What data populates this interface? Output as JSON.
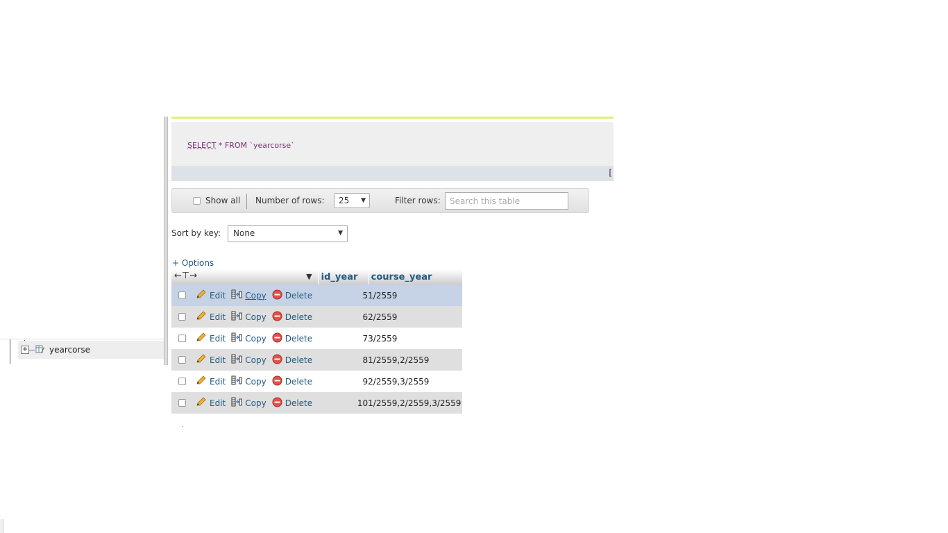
{
  "sidebar": {
    "table_item": "yearcorse",
    "expand_icon": "plus-square-icon",
    "table_icon": "table-icon"
  },
  "query": {
    "keyword": "SELECT",
    "rest": " * FROM `yearcorse`",
    "bracket": "["
  },
  "toolbar": {
    "show_all": "Show all",
    "rows_label": "Number of rows:",
    "rows_value": "25",
    "filter_label": "Filter rows:",
    "filter_placeholder": "Search this table"
  },
  "sort": {
    "label": "Sort by key:",
    "value": "None"
  },
  "options_label": "+ Options",
  "table": {
    "columns": [
      "id_year",
      "course_year"
    ],
    "actions": {
      "edit": "Edit",
      "copy": "Copy",
      "delete": "Delete"
    },
    "rows": [
      {
        "id_year": "5",
        "course_year": "1/2559"
      },
      {
        "id_year": "6",
        "course_year": "2/2559"
      },
      {
        "id_year": "7",
        "course_year": "3/2559"
      },
      {
        "id_year": "8",
        "course_year": "1/2559,2/2559"
      },
      {
        "id_year": "9",
        "course_year": "2/2559,3/2559"
      },
      {
        "id_year": "10",
        "course_year": "1/2559,2/2559,3/2559"
      }
    ]
  },
  "colors": {
    "link": "#235a81",
    "highlight_row": "#c6d3e6",
    "sql_highlight_bar": "#d9f27a"
  }
}
